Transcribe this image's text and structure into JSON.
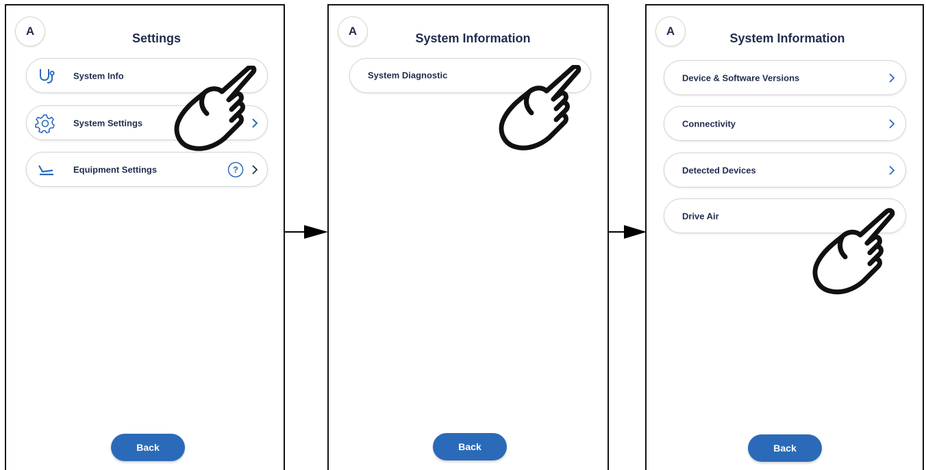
{
  "screens": [
    {
      "avatar": "A",
      "title": "Settings",
      "items": [
        {
          "label": "System Info",
          "icon": "stethoscope-icon"
        },
        {
          "label": "System Settings",
          "icon": "gear-icon"
        },
        {
          "label": "Equipment Settings",
          "icon": "dental-chair-icon",
          "help": "?"
        }
      ],
      "back": "Back"
    },
    {
      "avatar": "A",
      "title": "System Information",
      "items": [
        {
          "label": "System Diagnostic"
        }
      ],
      "back": "Back"
    },
    {
      "avatar": "A",
      "title": "System Information",
      "items": [
        {
          "label": "Device & Software Versions"
        },
        {
          "label": "Connectivity"
        },
        {
          "label": "Detected Devices"
        },
        {
          "label": "Drive Air"
        }
      ],
      "back": "Back"
    }
  ],
  "colors": {
    "accent": "#2b6ab8",
    "text": "#1f2d4d",
    "icon": "#2b6ab8"
  }
}
